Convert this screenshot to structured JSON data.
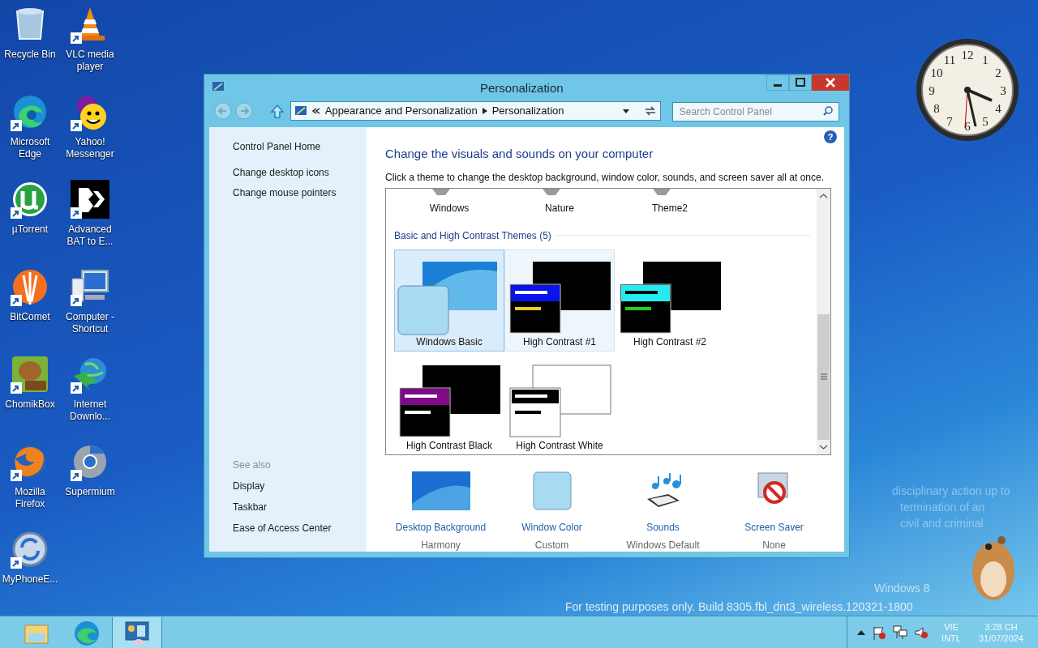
{
  "desktop_icons": [
    {
      "label": "Recycle Bin",
      "kind": "bin",
      "shortcut": false
    },
    {
      "label": "Microsoft Edge",
      "kind": "edge",
      "shortcut": true
    },
    {
      "label": "µTorrent",
      "kind": "torrent",
      "shortcut": true
    },
    {
      "label": "BitComet",
      "kind": "comet",
      "shortcut": true
    },
    {
      "label": "ChomikBox",
      "kind": "chomik",
      "shortcut": true
    },
    {
      "label": "Mozilla Firefox",
      "kind": "firefox",
      "shortcut": true
    },
    {
      "label": "MyPhoneE...",
      "kind": "sync",
      "shortcut": true
    },
    {
      "label": "VLC media player",
      "kind": "cone",
      "shortcut": true
    },
    {
      "label": "Yahoo! Messenger",
      "kind": "smiley",
      "shortcut": true
    },
    {
      "label": "Advanced BAT to E...",
      "kind": "bat",
      "shortcut": true
    },
    {
      "label": "Computer - Shortcut",
      "kind": "computer",
      "shortcut": true
    },
    {
      "label": "Internet Downlo...",
      "kind": "download",
      "shortcut": true
    },
    {
      "label": "Supermium",
      "kind": "supermium",
      "shortcut": true
    }
  ],
  "clock": {
    "numerals": [
      "12",
      "1",
      "2",
      "3",
      "4",
      "5",
      "6",
      "7",
      "8",
      "9",
      "10",
      "11"
    ]
  },
  "window": {
    "title": "Personalization",
    "address": {
      "crumbs": [
        "Appearance and Personalization",
        "Personalization"
      ]
    },
    "search": {
      "placeholder": "Search Control Panel"
    },
    "sidebar": {
      "links": [
        "Control Panel Home",
        "Change desktop icons",
        "Change mouse pointers"
      ],
      "see_also": {
        "title": "See also",
        "links": [
          "Display",
          "Taskbar",
          "Ease of Access Center"
        ]
      }
    },
    "help": "?",
    "heading": "Change the visuals and sounds on your computer",
    "description": "Click a theme to change the desktop background, window color, sounds, and screen saver all at once.",
    "top_themes": [
      {
        "label": "Windows"
      },
      {
        "label": "Nature"
      },
      {
        "label": "Theme2"
      }
    ],
    "section_title": "Basic and High Contrast Themes (5)",
    "themes": [
      {
        "label": "Windows Basic",
        "kind": "basic",
        "selected": true,
        "hovered": false
      },
      {
        "label": "High Contrast #1",
        "kind": "hc1",
        "selected": false,
        "hovered": true
      },
      {
        "label": "High Contrast #2",
        "kind": "hc2",
        "selected": false,
        "hovered": false
      },
      {
        "label": "High Contrast Black",
        "kind": "hcblack",
        "selected": false,
        "hovered": false
      },
      {
        "label": "High Contrast White",
        "kind": "hcwhite",
        "selected": false,
        "hovered": false
      }
    ],
    "settings": [
      {
        "label": "Desktop Background",
        "value": "Harmony",
        "kind": "wallpaper"
      },
      {
        "label": "Window Color",
        "value": "Custom",
        "kind": "color"
      },
      {
        "label": "Sounds",
        "value": "Windows Default",
        "kind": "sounds"
      },
      {
        "label": "Screen Saver",
        "value": "None",
        "kind": "screensaver"
      }
    ]
  },
  "desktop_text": {
    "notice_lines": [
      "disciplinary action up to",
      "termination of an",
      "civil and criminal"
    ],
    "edition": "Windows 8",
    "build": "For testing purposes only. Build 8305.fbl_dnt3_wireless.120321-1800"
  },
  "taskbar": {
    "apps": [
      {
        "kind": "folder",
        "active": false
      },
      {
        "kind": "edge",
        "active": false
      },
      {
        "kind": "panel",
        "active": true
      }
    ],
    "language": [
      "VIE",
      "INTL"
    ],
    "time": "3:28 CH",
    "date": "31/07/2024"
  }
}
